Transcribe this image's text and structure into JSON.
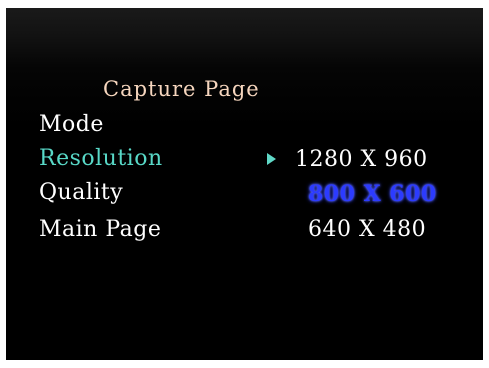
{
  "screen": {
    "title": "Capture Page",
    "menu": [
      {
        "label": "Mode"
      },
      {
        "label": "Resolution"
      },
      {
        "label": "Quality"
      },
      {
        "label": "Main Page"
      }
    ],
    "selected_menu": "Resolution",
    "options": [
      {
        "label": "1280 X 960"
      },
      {
        "label": "800 X 600"
      },
      {
        "label": "640 X 480"
      }
    ],
    "highlighted_option": "800 X 600",
    "colors": {
      "title": "#f6d6be",
      "selected_menu": "#58d8c7",
      "highlight": "#2c3bff",
      "text": "#ffffff",
      "background": "#000000"
    },
    "icons": {
      "cursor": "play-triangle-icon"
    }
  }
}
